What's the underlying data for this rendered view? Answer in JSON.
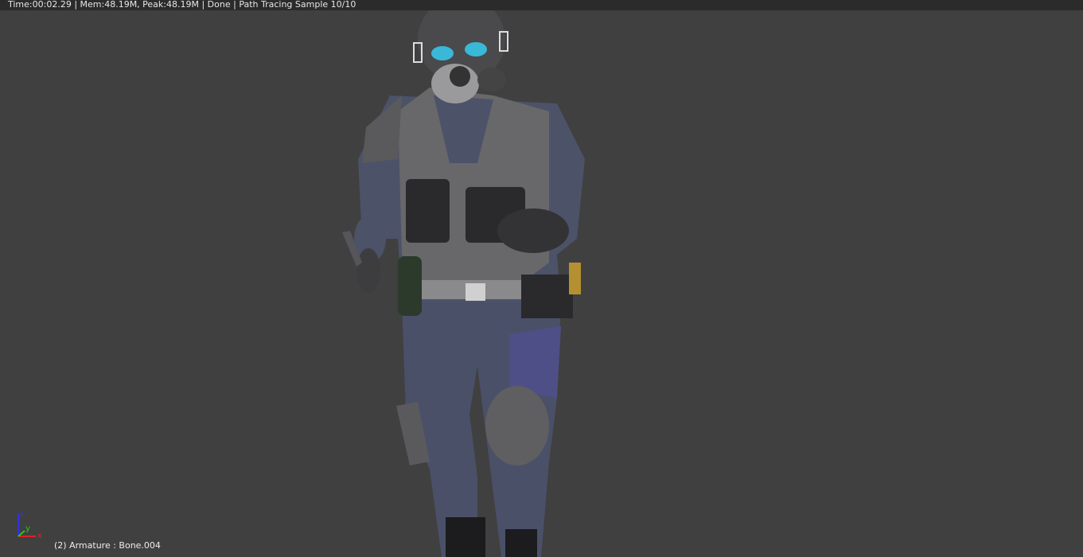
{
  "header": {
    "status": "Time:00:02.29 | Mem:48.19M, Peak:48.19M | Done | Path Tracing Sample 10/10"
  },
  "viewport": {
    "object_info": "(2) Armature : Bone.004",
    "axes": {
      "x": "x",
      "y": "y",
      "z": "z"
    },
    "colors": {
      "background": "#404040",
      "x_axis": "#d22",
      "y_axis": "#2c2",
      "z_axis": "#33d",
      "visor": "#3ab8d8"
    }
  }
}
